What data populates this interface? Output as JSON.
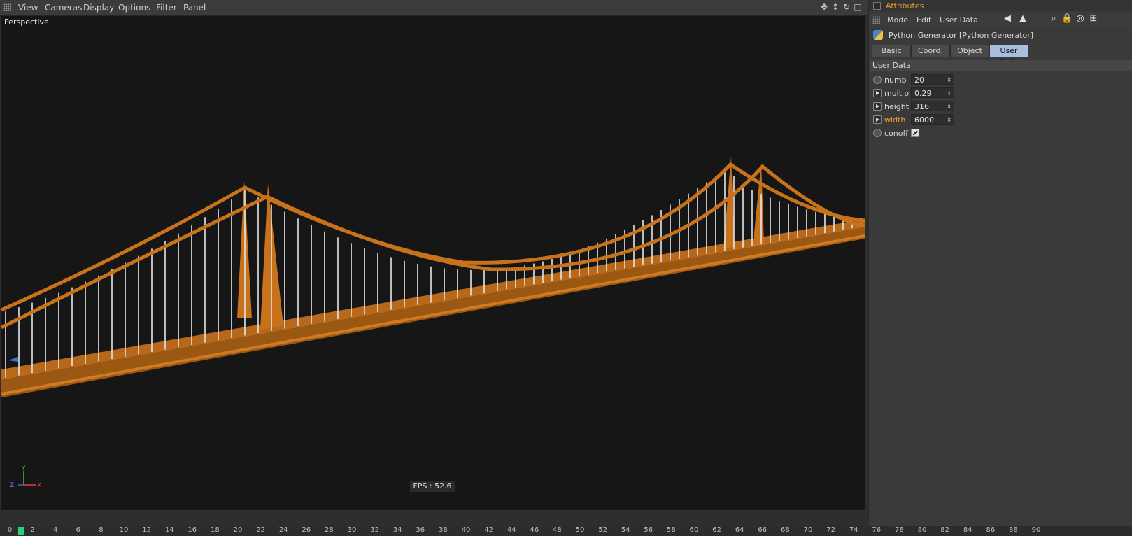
{
  "viewport": {
    "menu": [
      "View",
      "Cameras",
      "Display",
      "Options",
      "Filter",
      "Panel"
    ],
    "label": "Perspective",
    "fps": "FPS : 52.6",
    "axis": {
      "y": "Y",
      "z": "Z",
      "x": "X"
    },
    "tool_icons": [
      "move-view-icon",
      "dolly-view-icon",
      "rotate-view-icon",
      "maximize-view-icon"
    ]
  },
  "attributes": {
    "title": "Attributes",
    "menu": [
      "Mode",
      "Edit",
      "User Data"
    ],
    "object_name": "Python Generator [Python Generator]",
    "tabs": [
      {
        "label": "Basic",
        "active": false
      },
      {
        "label": "Coord.",
        "active": false
      },
      {
        "label": "Object",
        "active": false
      },
      {
        "label": "User Data",
        "active": true
      }
    ],
    "section": "User Data",
    "params": [
      {
        "label": "numb",
        "value": "20"
      },
      {
        "label": "multip",
        "value": "0.29"
      },
      {
        "label": "height",
        "value": "316"
      },
      {
        "label": "width",
        "value": "6000",
        "highlighted": true
      },
      {
        "label": "conoff",
        "checked": true
      }
    ]
  },
  "timeline": {
    "ticks": [
      "0",
      "2",
      "4",
      "6",
      "8",
      "10",
      "12",
      "14",
      "16",
      "18",
      "20",
      "22",
      "24",
      "26",
      "28",
      "30",
      "32",
      "34",
      "36",
      "38",
      "40",
      "42",
      "44",
      "46",
      "48",
      "50",
      "52",
      "54",
      "56",
      "58",
      "60",
      "62",
      "64",
      "66",
      "68",
      "70",
      "72",
      "74",
      "76",
      "78",
      "80",
      "82",
      "84",
      "86",
      "88",
      "90"
    ],
    "current_frame": "1"
  },
  "colors": {
    "bridge": "#c8731c",
    "cables": "#e6e6e6",
    "accent": "#f0a030",
    "active_tab": "#a8c0e0"
  }
}
